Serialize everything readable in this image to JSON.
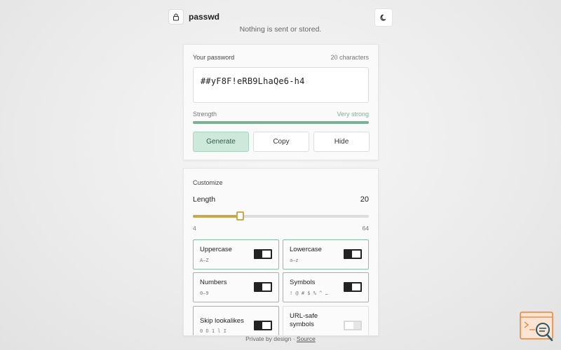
{
  "app": {
    "title": "passwd",
    "tagline": "Nothing is sent or stored."
  },
  "password": {
    "section_label": "Your password",
    "char_count": "20 characters",
    "value": "##yF8F!eRB9LhaQe6-h4",
    "strength_label": "Strength",
    "strength_value": "Very strong",
    "strength_level": 1.0
  },
  "actions": {
    "generate": "Generate",
    "copy": "Copy",
    "hide": "Hide"
  },
  "customize": {
    "section_label": "Customize",
    "length_label": "Length",
    "length_value": "20",
    "length_min": "4",
    "length_max": "64",
    "length_fraction": 0.2667,
    "options": [
      {
        "label": "Uppercase",
        "sub": "A–Z",
        "on": true
      },
      {
        "label": "Lowercase",
        "sub": "a–z",
        "on": true
      },
      {
        "label": "Numbers",
        "sub": "0–9",
        "on": true
      },
      {
        "label": "Symbols",
        "sub": "! @ # $ % ^ …",
        "on": true
      },
      {
        "label": "Skip lookalikes",
        "sub": "0 O 1 l I",
        "on": true
      },
      {
        "label": "URL-safe symbols",
        "sub": "",
        "on": false
      }
    ]
  },
  "footer": {
    "text": "Private by design · ",
    "link": "Source"
  },
  "colors": {
    "accent_green": "#7bb296",
    "slider_gold": "#c9a84e",
    "fab_orange": "#e8843c"
  }
}
